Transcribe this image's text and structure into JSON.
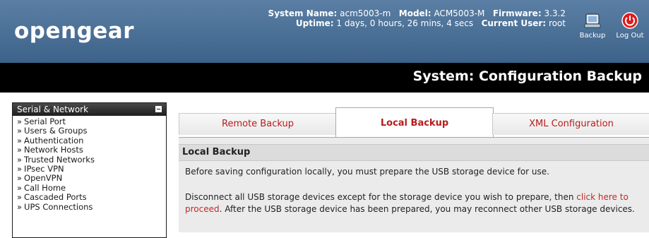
{
  "header": {
    "logo": "opengear",
    "system_name_label": "System Name:",
    "system_name": "acm5003-m",
    "model_label": "Model:",
    "model": "ACM5003-M",
    "firmware_label": "Firmware:",
    "firmware": "3.3.2",
    "uptime_label": "Uptime:",
    "uptime": "1 days, 0 hours, 26 mins, 4 secs",
    "current_user_label": "Current User:",
    "current_user": "root",
    "backup_label": "Backup",
    "logout_label": "Log Out"
  },
  "page_title": "System: Configuration Backup",
  "sidebar": {
    "heading": "Serial & Network",
    "items": [
      {
        "label": "Serial Port"
      },
      {
        "label": "Users & Groups"
      },
      {
        "label": "Authentication"
      },
      {
        "label": "Network Hosts"
      },
      {
        "label": "Trusted Networks"
      },
      {
        "label": "IPsec VPN"
      },
      {
        "label": "OpenVPN"
      },
      {
        "label": "Call Home"
      },
      {
        "label": "Cascaded Ports"
      },
      {
        "label": "UPS Connections"
      }
    ]
  },
  "tabs": [
    {
      "label": "Remote Backup"
    },
    {
      "label": "Local Backup"
    },
    {
      "label": "XML Configuration"
    }
  ],
  "panel": {
    "heading": "Local Backup",
    "para1": "Before saving configuration locally, you must prepare the USB storage device for use.",
    "para2_before": "Disconnect all USB storage devices except for the storage device you wish to prepare, then ",
    "para2_link": "click here to proceed",
    "para2_after": ". After the USB storage device has been prepared, you may reconnect other USB storage devices."
  },
  "colors": {
    "header_top": "#5b7fa4",
    "header_bottom": "#3d6289",
    "link_red": "#c62828"
  }
}
